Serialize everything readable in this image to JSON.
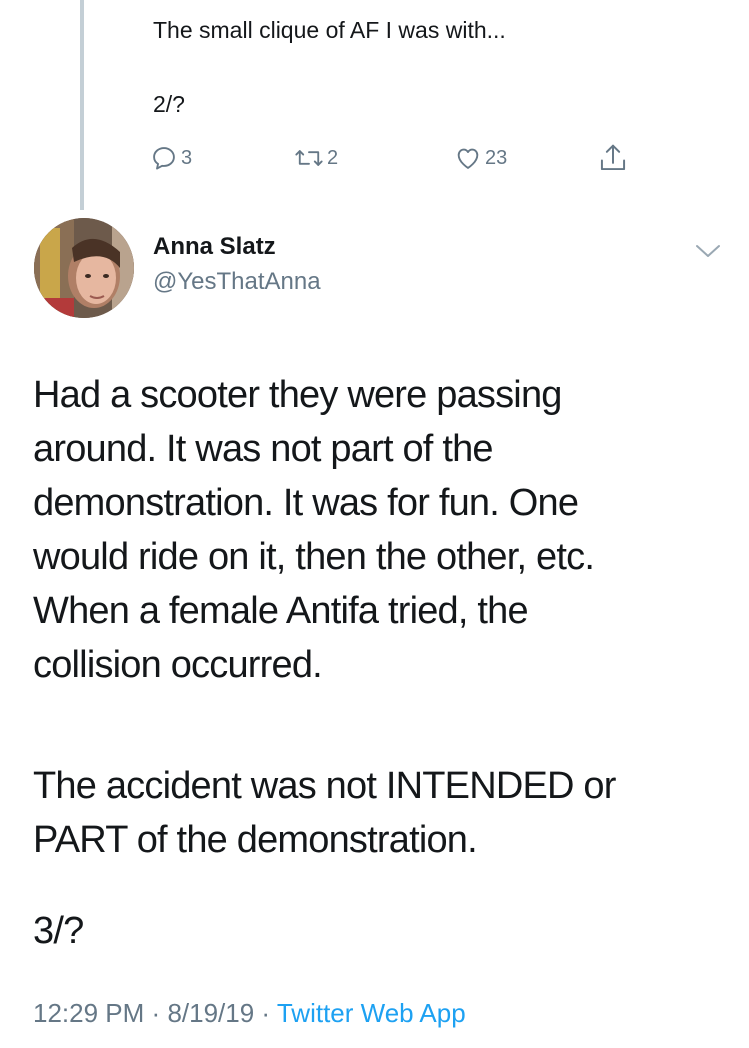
{
  "previous_tweet": {
    "text_line1": "The small clique of AF I was with...",
    "text_line2": "2/?",
    "actions": {
      "reply_count": "3",
      "retweet_count": "2",
      "like_count": "23"
    },
    "icons": [
      "reply-icon",
      "retweet-icon",
      "like-icon",
      "share-icon"
    ]
  },
  "tweet": {
    "author_name": "Anna Slatz",
    "author_handle": "@YesThatAnna",
    "paragraph1_lines": [
      "Had a scooter they were passing",
      "around. It was not part of the",
      "demonstration. It was for fun. One",
      "would ride on it, then the other, etc.",
      "When a female Antifa tried, the",
      "collision occurred."
    ],
    "paragraph2_lines": [
      "The accident was not INTENDED or",
      "PART of the demonstration."
    ],
    "paragraph3": "3/?",
    "time": "12:29 PM",
    "separator": "·",
    "date": "8/19/19",
    "source": "Twitter Web App"
  },
  "colors": {
    "text": "#14171a",
    "secondary": "#657786",
    "link": "#1da1f2",
    "thread_line": "#c4cfd6"
  }
}
